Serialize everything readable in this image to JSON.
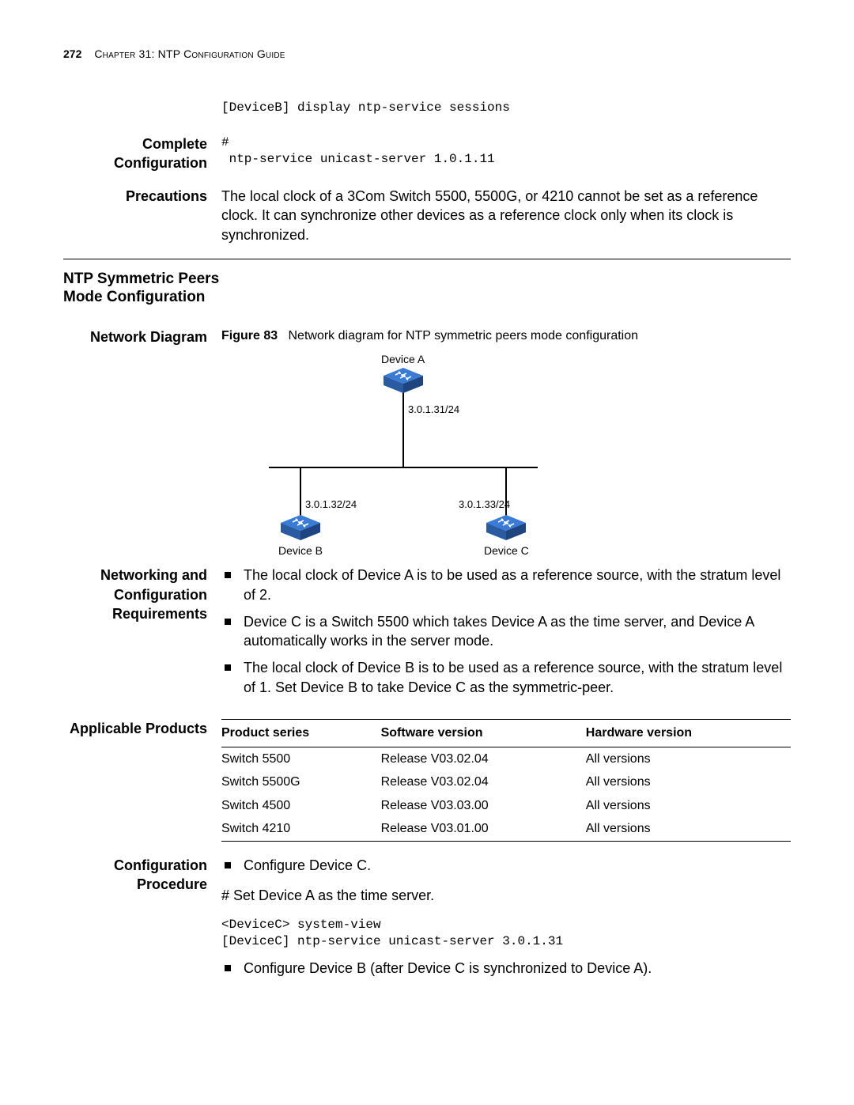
{
  "header": {
    "page_number": "272",
    "chapter_label": "Chapter 31: NTP Configuration Guide"
  },
  "top_code": "[DeviceB] display ntp-service sessions",
  "sections": {
    "complete_config": {
      "label": "Complete Configuration",
      "code": "#\n ntp-service unicast-server 1.0.1.11"
    },
    "precautions": {
      "label": "Precautions",
      "text": "The local clock of a 3Com Switch 5500, 5500G, or 4210 cannot be set as a reference clock. It can synchronize other devices as a reference clock only when its clock is synchronized."
    },
    "main_heading": "NTP Symmetric Peers Mode Configuration",
    "network_diagram": {
      "label": "Network Diagram",
      "figure_number": "Figure 83",
      "figure_caption": "Network diagram for NTP symmetric peers mode configuration",
      "devices": {
        "a": {
          "name": "Device A",
          "ip": "3.0.1.31/24"
        },
        "b": {
          "name": "Device B",
          "ip": "3.0.1.32/24"
        },
        "c": {
          "name": "Device C",
          "ip": "3.0.1.33/24"
        }
      }
    },
    "networking_requirements": {
      "label": "Networking and Configuration Requirements",
      "bullets": [
        "The local clock of Device A is to be used as a reference source, with the stratum level of 2.",
        "Device C is a Switch 5500 which takes Device A as the time server, and Device A automatically works in the server mode.",
        "The local clock of Device B is to be used as a reference source, with the stratum level of 1. Set Device B to take Device C as the symmetric-peer."
      ]
    },
    "applicable_products": {
      "label": "Applicable Products",
      "columns": [
        "Product series",
        "Software version",
        "Hardware version"
      ],
      "rows": [
        [
          "Switch 5500",
          "Release V03.02.04",
          "All versions"
        ],
        [
          "Switch 5500G",
          "Release V03.02.04",
          "All versions"
        ],
        [
          "Switch 4500",
          "Release V03.03.00",
          "All versions"
        ],
        [
          "Switch 4210",
          "Release V03.01.00",
          "All versions"
        ]
      ]
    },
    "config_procedure": {
      "label": "Configuration Procedure",
      "bullet1": "Configure Device C.",
      "step1_comment": "# Set Device A as the time server.",
      "step1_code": "<DeviceC> system-view\n[DeviceC] ntp-service unicast-server 3.0.1.31",
      "bullet2": "Configure Device B (after Device C is synchronized to Device A)."
    }
  }
}
